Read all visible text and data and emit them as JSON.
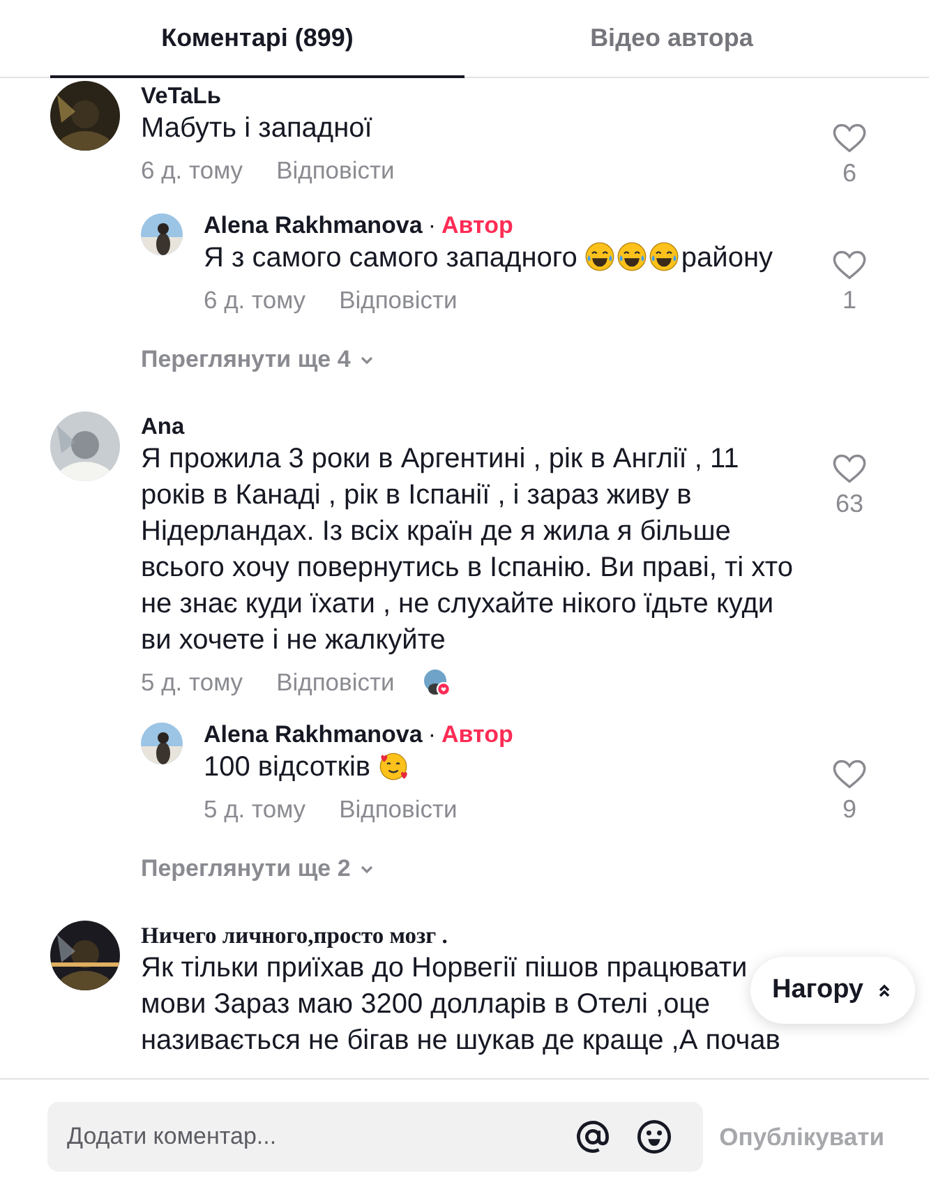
{
  "tabs": [
    {
      "label": "Коментарі (899)",
      "selected": true
    },
    {
      "label": "Відео автора",
      "selected": false
    }
  ],
  "comments": [
    {
      "author": "VeTaLь",
      "author_serif": false,
      "parts": [
        {
          "kind": "text",
          "text": "Мабуть і западної"
        }
      ],
      "time": "6 д. тому",
      "reply_label": "Відповісти",
      "likes": "6",
      "liked_by_author": false,
      "replies": [
        {
          "author": "Alena Rakhmanova",
          "separator": "·",
          "badge": "Автор",
          "parts": [
            {
              "kind": "text",
              "text": "Я з самого самого западного "
            },
            {
              "kind": "laughing-emoji"
            },
            {
              "kind": "laughing-emoji"
            },
            {
              "kind": "laughing-emoji"
            },
            {
              "kind": "text",
              "text": "району"
            }
          ],
          "time": "6 д. тому",
          "reply_label": "Відповісти",
          "likes": "1"
        }
      ],
      "view_more": "Переглянути ще 4"
    },
    {
      "author": "Ana",
      "author_serif": false,
      "parts": [
        {
          "kind": "text",
          "text": "Я прожила 3 роки в Аргентині , рік в Англії , 11 років в Канаді , рік в Іспанії , і зараз живу в Нідерландах. Із всіх країн де я жила я більше всього хочу повернутись в Іспанію. Ви праві, ті хто не знає куди їхати , не слухайте нікого їдьте куди ви хочете і не жалкуйте"
        }
      ],
      "time": "5 д. тому",
      "reply_label": "Відповісти",
      "likes": "63",
      "liked_by_author": true,
      "replies": [
        {
          "author": "Alena Rakhmanova",
          "separator": "·",
          "badge": "Автор",
          "parts": [
            {
              "kind": "text",
              "text": "100 відсотків "
            },
            {
              "kind": "hearts-emoji"
            }
          ],
          "time": "5 д. тому",
          "reply_label": "Відповісти",
          "likes": "9"
        }
      ],
      "view_more": "Переглянути ще 2"
    },
    {
      "author": "Ничего личного,просто мозг .",
      "author_serif": true,
      "lines": [
        "Як тільки приїхав до Норвегії пішов працювати",
        "мови Зараз маю 3200 долларів в Отелі ,оце",
        "називається не бігав не шукав де краще ,А почав"
      ]
    }
  ],
  "scroll_top_button": {
    "label": "Нагору"
  },
  "composer": {
    "placeholder": "Додати коментар...",
    "post_label": "Опублікувати",
    "post_disabled": true
  }
}
